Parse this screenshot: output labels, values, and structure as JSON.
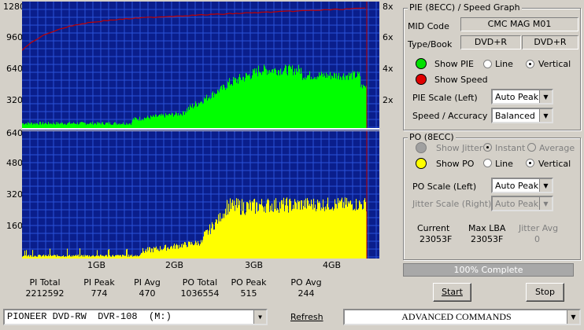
{
  "pie_graph": {
    "left_ticks": [
      "1280",
      "960",
      "640",
      "320"
    ],
    "right_ticks": [
      "8x",
      "6x",
      "4x",
      "2x"
    ],
    "colors": {
      "background": "#0a1e8c",
      "grid": "#2a52d8",
      "pie": "#00ff00",
      "speed": "#c00000",
      "end_marker": "#c00000"
    }
  },
  "po_graph": {
    "left_ticks": [
      "640",
      "480",
      "320",
      "160"
    ],
    "x_ticks": [
      "1GB",
      "2GB",
      "3GB",
      "4GB"
    ],
    "colors": {
      "background": "#0a1e8c",
      "grid": "#2a52d8",
      "po": "#ffff00",
      "end_marker": "#c00000"
    }
  },
  "stats": [
    {
      "label": "PI Total",
      "value": "2212592"
    },
    {
      "label": "PI Peak",
      "value": "774"
    },
    {
      "label": "PI Avg",
      "value": "470"
    },
    {
      "label": "PO Total",
      "value": "1036554"
    },
    {
      "label": "PO Peak",
      "value": "515"
    },
    {
      "label": "PO Avg",
      "value": "244"
    }
  ],
  "pie_panel": {
    "title": "PIE (8ECC) / Speed Graph",
    "mid_code_label": "MID Code",
    "mid_code_value": "CMC MAG M01",
    "type_book_label": "Type/Book",
    "type_value": "DVD+R",
    "book_value": "DVD+R",
    "show_pie_label": "Show PIE",
    "line_label": "Line",
    "vertical_label": "Vertical",
    "show_speed_label": "Show Speed",
    "pie_scale_label": "PIE Scale (Left)",
    "pie_scale_value": "Auto Peak",
    "speed_accuracy_label": "Speed / Accuracy",
    "speed_accuracy_value": "Balanced"
  },
  "po_panel": {
    "title": "PO (8ECC)",
    "show_jitter_label": "Show Jitter",
    "instant_label": "Instant",
    "average_label": "Average",
    "show_po_label": "Show PO",
    "line_label": "Line",
    "vertical_label": "Vertical",
    "po_scale_label": "PO Scale (Left)",
    "po_scale_value": "Auto Peak",
    "jitter_scale_label": "Jitter Scale (Right)",
    "jitter_scale_value": "Auto Peak",
    "current_label": "Current",
    "current_value": "23053F",
    "max_lba_label": "Max LBA",
    "max_lba_value": "23053F",
    "jitter_avg_label": "Jitter Avg",
    "jitter_avg_value": "0"
  },
  "progress": {
    "text": "100% Complete",
    "value": 100
  },
  "buttons": {
    "start": "Start",
    "stop": "Stop",
    "refresh": "Refresh"
  },
  "drive_select": {
    "value": "PIONEER DVD-RW  DVR-108  (M:)"
  },
  "commands_select": {
    "value": "ADVANCED COMMANDS"
  }
}
